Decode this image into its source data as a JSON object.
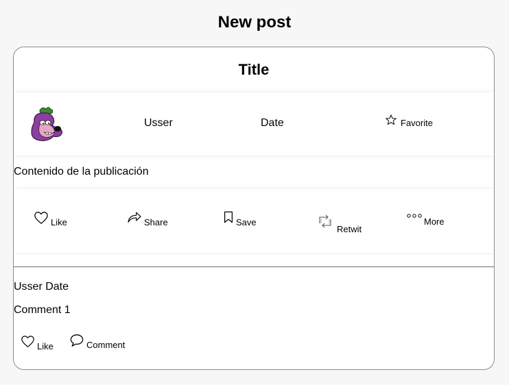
{
  "page": {
    "title": "New post"
  },
  "post": {
    "title": "Title",
    "user": "Usser",
    "date": "Date",
    "favorite_label": "Favorite",
    "content": "Contenido de la publicación",
    "avatar_icon": "cartoon-dog-avatar",
    "actions": {
      "like": "Like",
      "share": "Share",
      "save": "Save",
      "retwit": "Retwit",
      "more": "More"
    }
  },
  "comment": {
    "meta": "Usser Date",
    "body": "Comment 1",
    "actions": {
      "like": "Like",
      "comment": "Comment"
    }
  },
  "colors": {
    "background": "#f7f7f7",
    "card": "#ffffff",
    "card_border": "#8c8c8c",
    "avatar_purple": "#8b3f9e",
    "avatar_green": "#3c8a2e"
  }
}
